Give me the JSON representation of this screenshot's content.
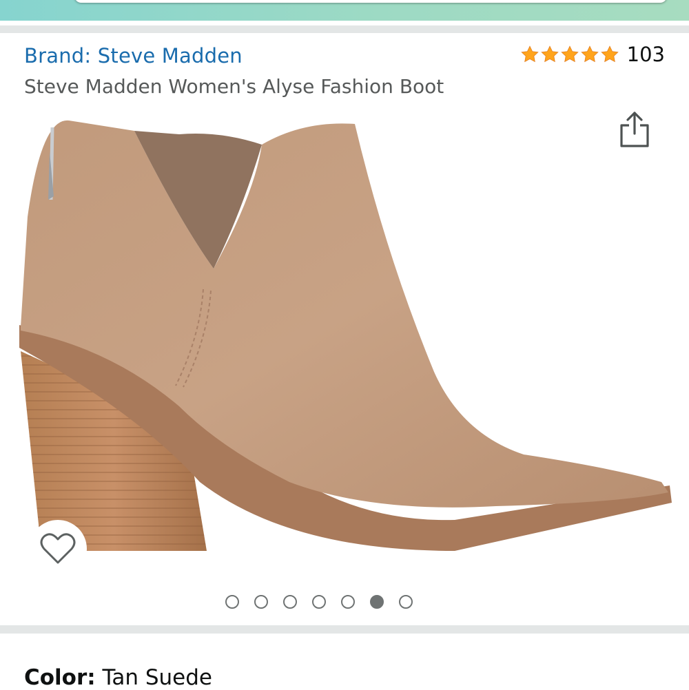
{
  "header": {
    "search": {
      "placeholder": ""
    }
  },
  "product": {
    "brand_label": "Brand: Steve Madden",
    "title": "Steve Madden Women's Alyse Fashion Boot",
    "rating": {
      "stars": 5,
      "count": "103"
    },
    "image_alt": "Tan suede pointed-toe ankle boot with stacked block heel",
    "gallery": {
      "total": 7,
      "active_index": 5
    },
    "color": {
      "label": "Color:",
      "value": "Tan Suede"
    }
  },
  "icons": {
    "share": "share-icon",
    "wishlist": "heart-outline-icon",
    "star": "star-icon"
  },
  "colors": {
    "link": "#1a6cad",
    "star": "#ffa41c",
    "header_teal": "#86d4cf",
    "band_gray": "#e3e6e6",
    "dot": "#6f7373"
  }
}
